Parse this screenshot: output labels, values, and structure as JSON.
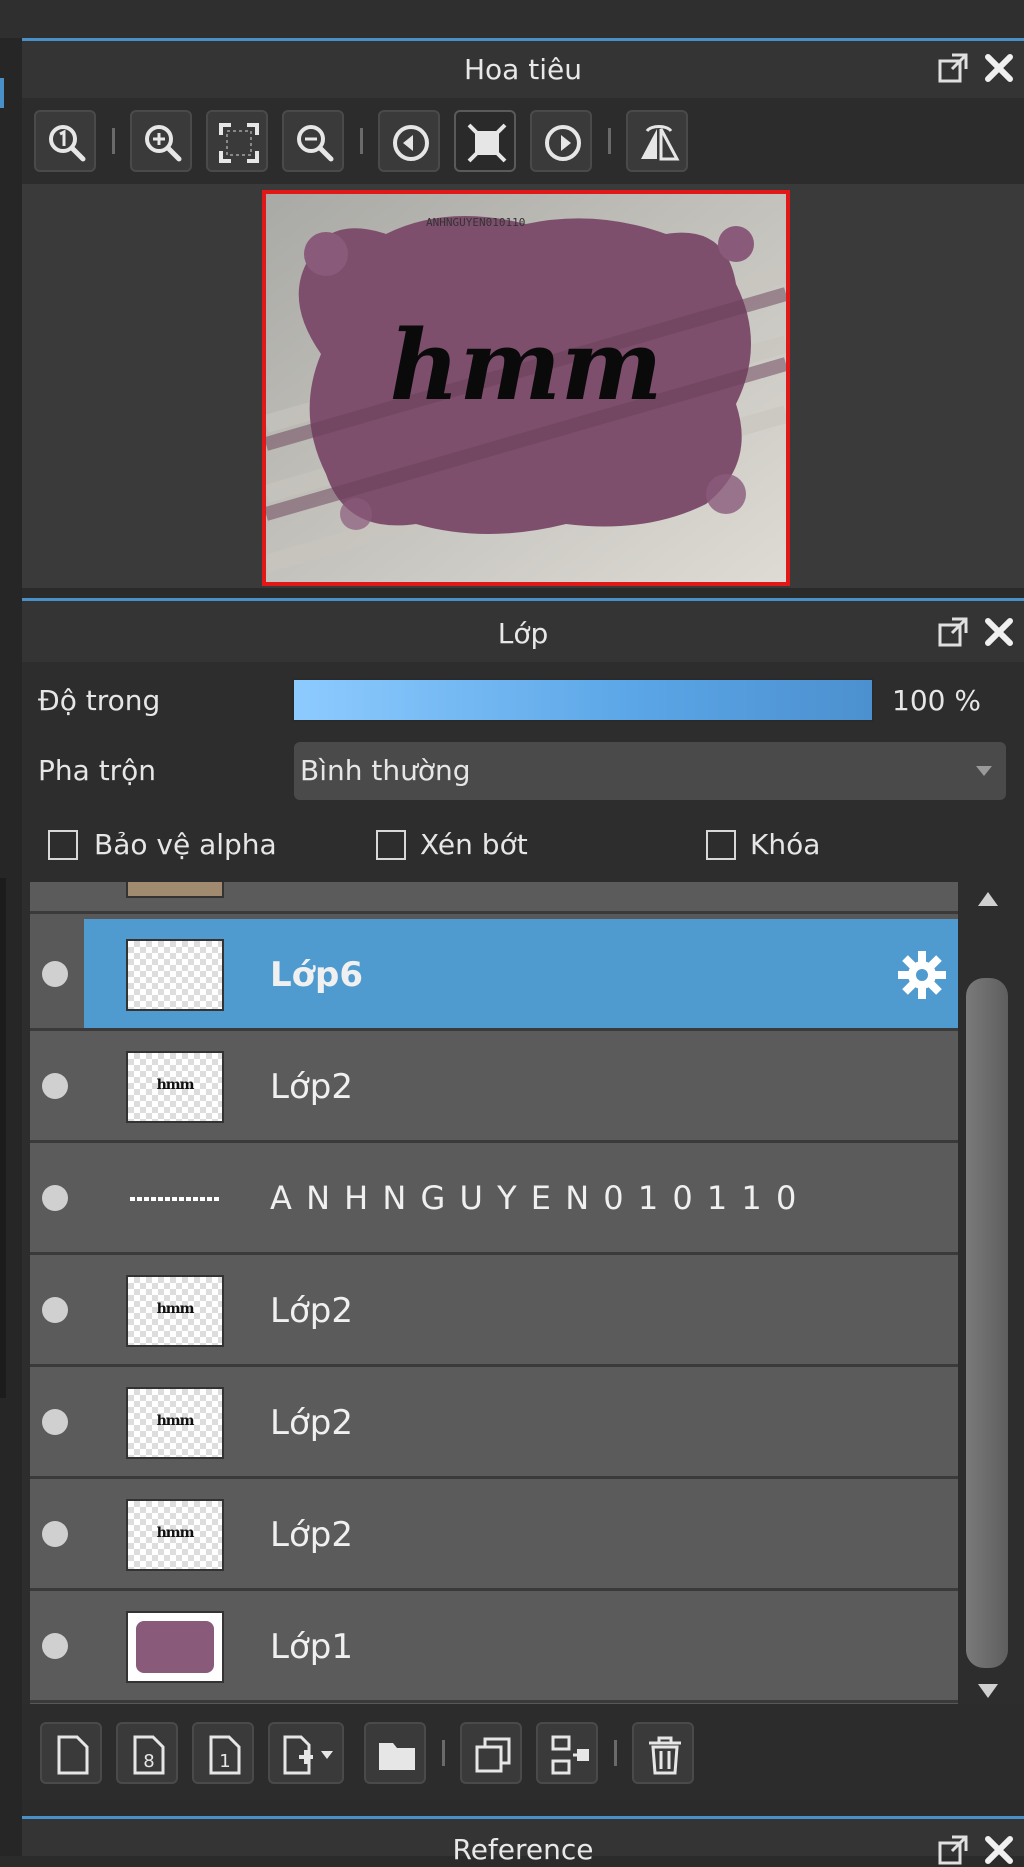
{
  "navigator": {
    "title": "Hoa tiêu",
    "tools": [
      "zoom-actual-icon",
      "zoom-in-icon",
      "fit-icon",
      "zoom-out-icon",
      "rotate-left-icon",
      "fit-window-icon",
      "rotate-right-icon",
      "flip-icon"
    ],
    "preview_text": "hmm",
    "preview_caption": "ANHNGUYEN010110"
  },
  "layers": {
    "title": "Lớp",
    "opacity_label": "Độ trong",
    "opacity_value": "100 %",
    "opacity_fraction": 1.0,
    "blend_label": "Pha trộn",
    "blend_value": "Bình thường",
    "protect_alpha_label": "Bảo vệ alpha",
    "clip_label": "Xén bớt",
    "lock_label": "Khóa",
    "items": [
      {
        "name": "Lớp6",
        "selected": true,
        "thumb": "empty"
      },
      {
        "name": "Lớp2",
        "selected": false,
        "thumb": "hmm"
      },
      {
        "name": "A N H N G U Y E N 0 1 0 1 1 0",
        "selected": false,
        "thumb": "text"
      },
      {
        "name": "Lớp2",
        "selected": false,
        "thumb": "hmm"
      },
      {
        "name": "Lớp2",
        "selected": false,
        "thumb": "hmm"
      },
      {
        "name": "Lớp2",
        "selected": false,
        "thumb": "hmm"
      },
      {
        "name": "Lớp1",
        "selected": false,
        "thumb": "purple"
      }
    ],
    "thumb_mini": "hmm"
  },
  "reference": {
    "title": "Reference"
  },
  "colors": {
    "accent": "#4f9bd0",
    "selection": "#4f9bd0",
    "preview_border": "#e01818",
    "layer_purple": "#8a5a7a"
  }
}
